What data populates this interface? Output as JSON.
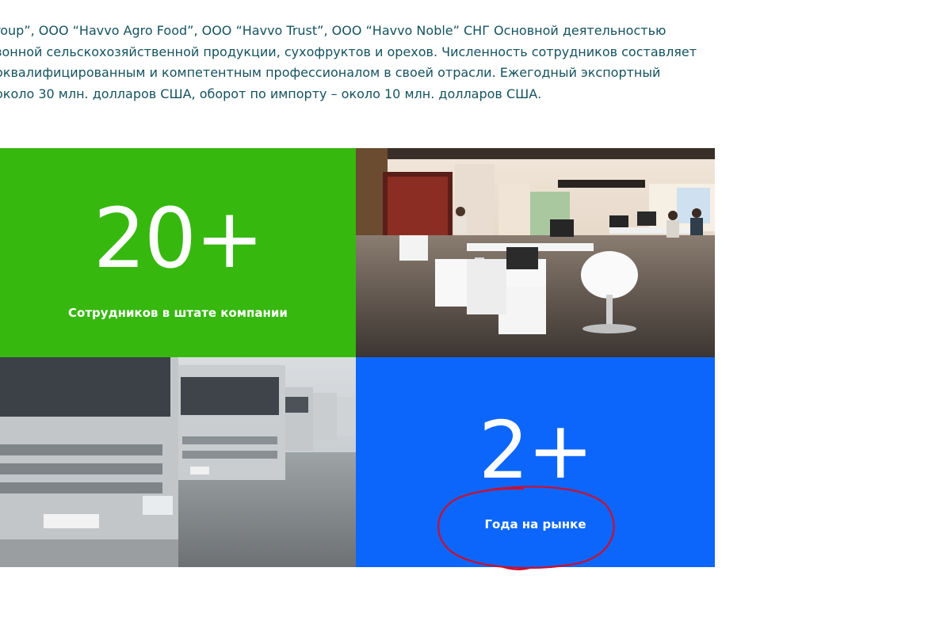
{
  "intro": {
    "lines": [
      "roup”, ООО “Havvo Agro Food”, ООО “Havvo Trust”, ООО “Havvo Noble” СНГ Основной деятельностью",
      "зонной сельскохозяйственной продукции, сухофруктов и орехов. Численность сотрудников составляет",
      "оквалифицированным и компетентным профессионалом в своей отрасли. Ежегодный экспортный",
      "около 30 млн. долларов США, оборот по импорту – около 10 млн. долларов США."
    ]
  },
  "stats": [
    {
      "number": "20+",
      "label": "Сотрудников в штате компании",
      "color": "#36b80f"
    },
    {
      "number": "2+",
      "label": "Года на рынке",
      "color": "#0d66fb"
    }
  ],
  "photos": {
    "office": "office-photo",
    "trucks": "trucks-photo"
  },
  "annotation": {
    "color": "#c8102e"
  }
}
